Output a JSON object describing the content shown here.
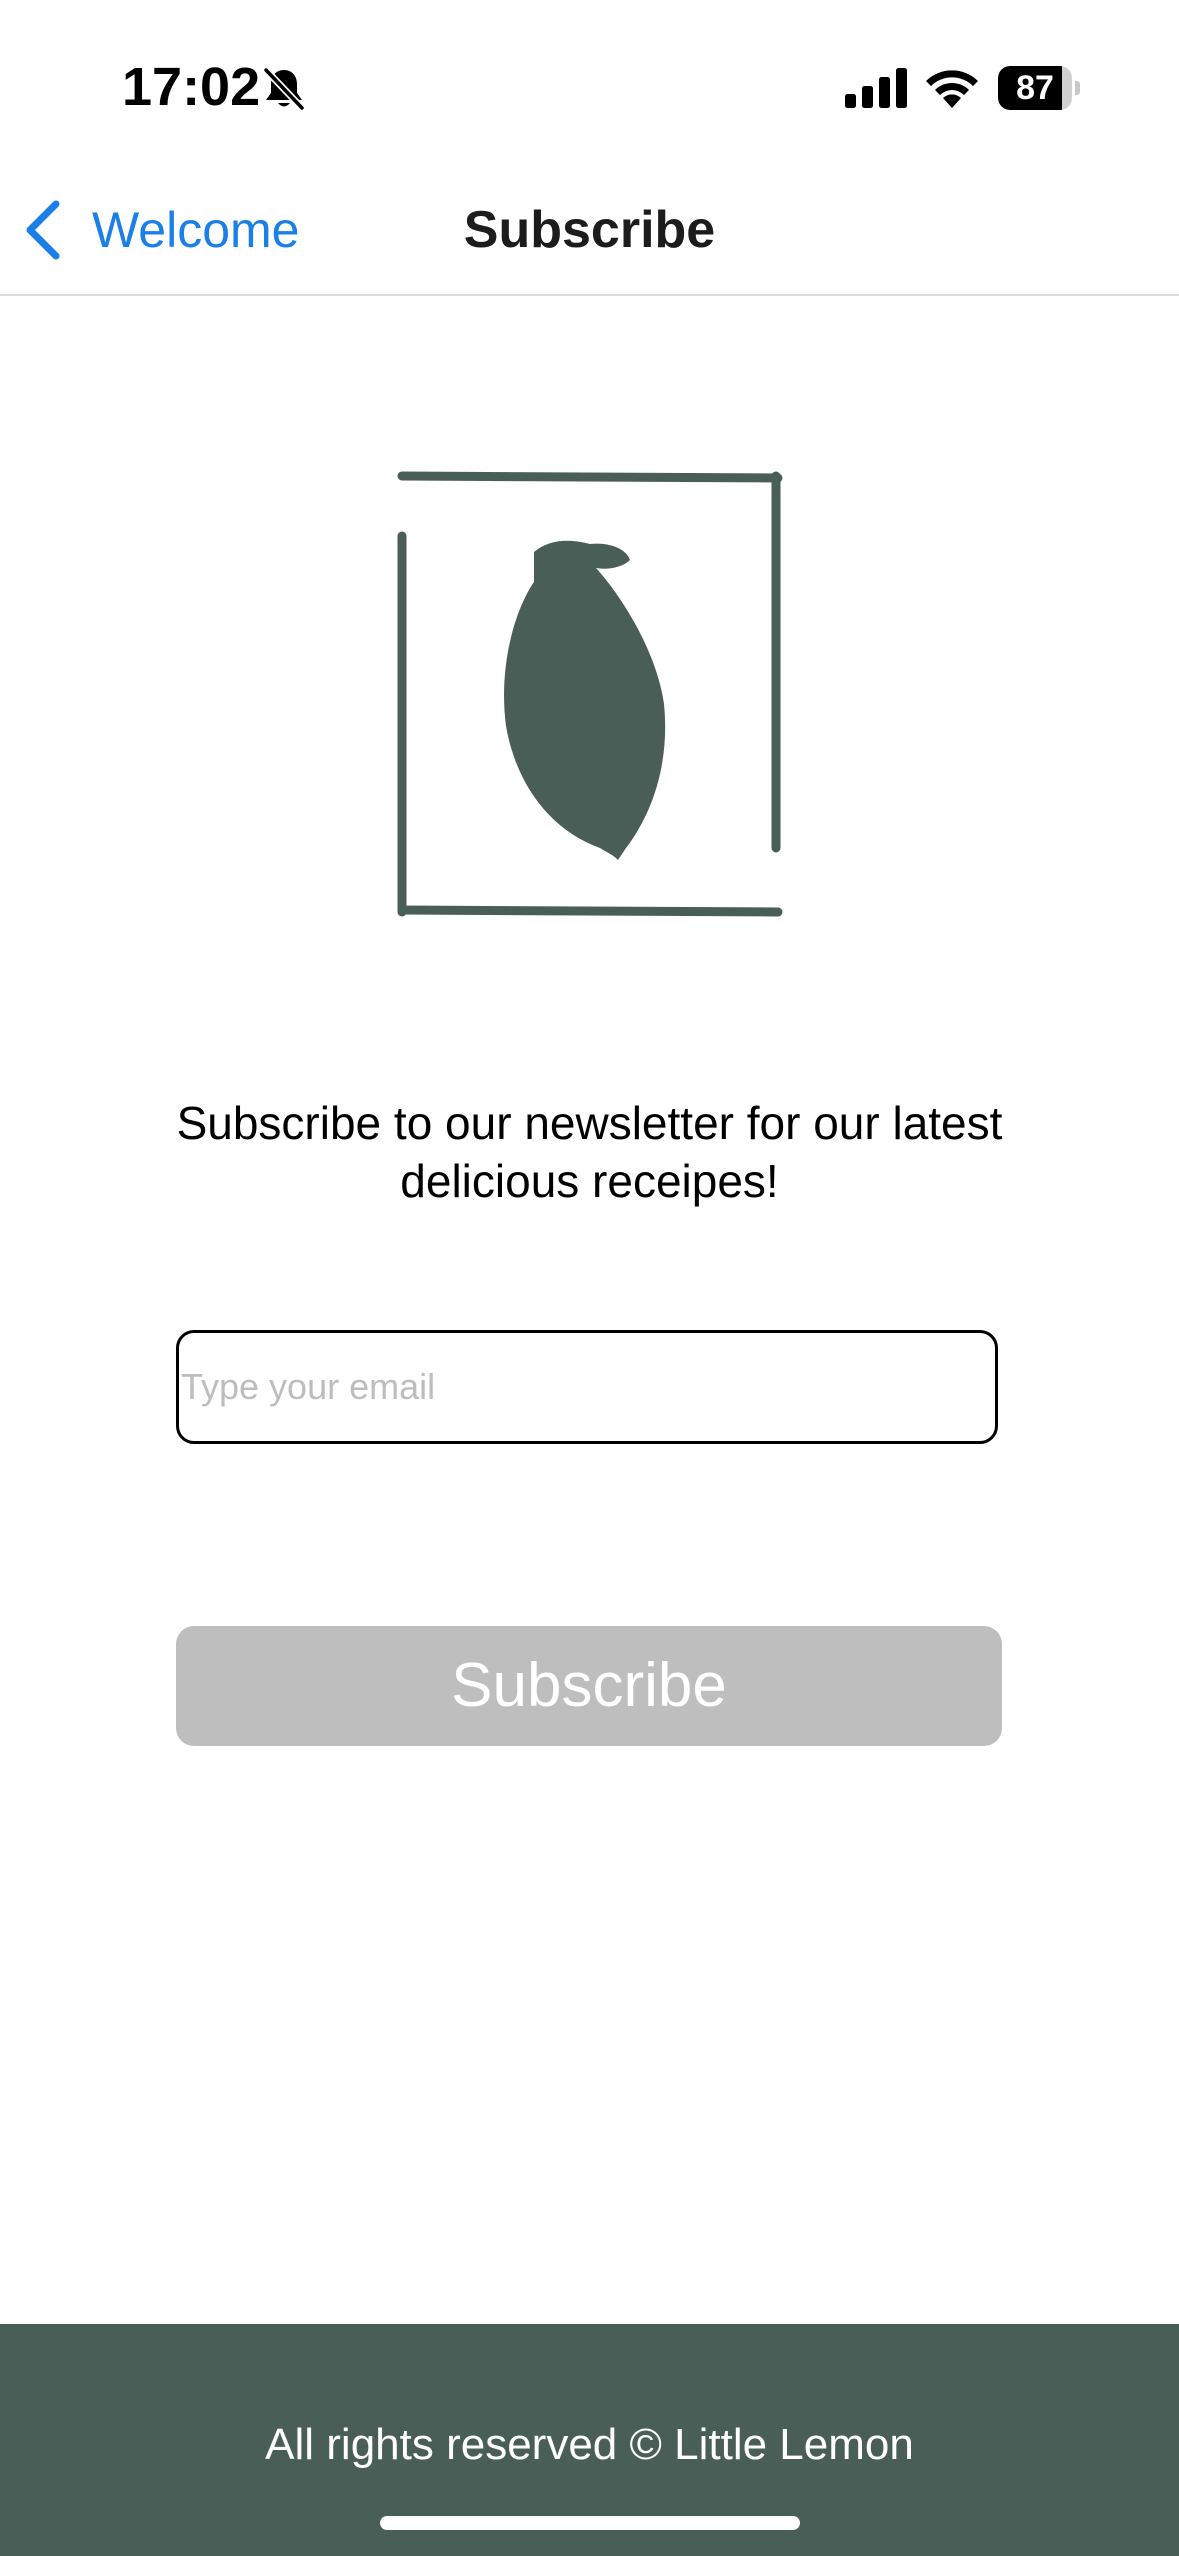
{
  "status_bar": {
    "time": "17:02",
    "battery_level": "87",
    "battery_fraction": 0.87,
    "icons": [
      "bell-slash-icon",
      "cellular-signal-icon",
      "wifi-icon",
      "battery-icon"
    ]
  },
  "nav": {
    "back_label": "Welcome",
    "title": "Subscribe",
    "back_icon": "chevron-left-icon"
  },
  "logo": {
    "icon": "lemon-logo-icon"
  },
  "main": {
    "description": "Subscribe to our newsletter for our latest delicious receipes!",
    "email_placeholder": "Type your email",
    "email_value": "",
    "subscribe_label": "Subscribe"
  },
  "footer": {
    "text": "All rights reserved © Little Lemon"
  },
  "colors": {
    "accent_link": "#1a7fe6",
    "brand_green": "#495e57",
    "button_disabled": "#bebebe"
  }
}
